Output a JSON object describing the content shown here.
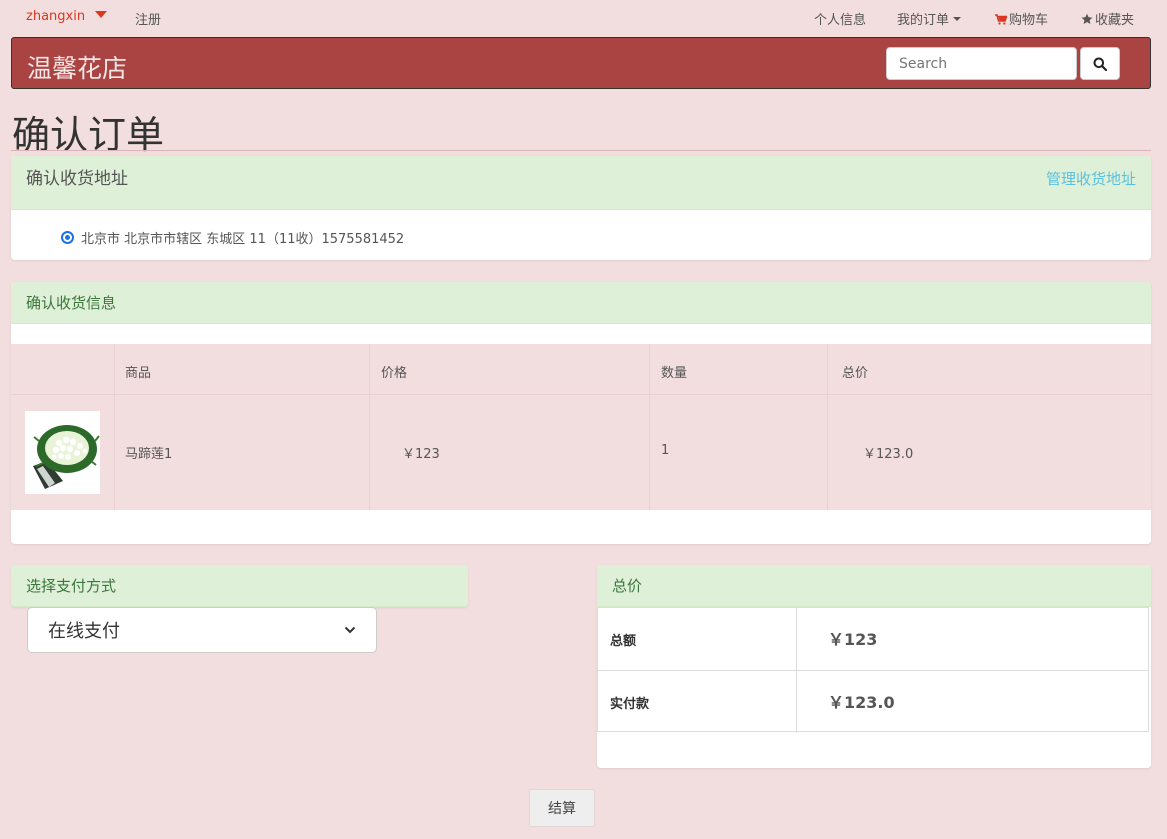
{
  "topbar": {
    "user": "zhangxin",
    "register": "注册",
    "profile": "个人信息",
    "orders": "我的订单",
    "cart": "购物车",
    "favorites": "收藏夹"
  },
  "navbar": {
    "brand": "温馨花店",
    "search_placeholder": "Search"
  },
  "page": {
    "title": "确认订单"
  },
  "address": {
    "heading": "确认收货地址",
    "manage_link": "管理收货地址",
    "selected": "北京市 北京市市辖区 东城区 11（11收）1575581452"
  },
  "goods": {
    "heading": "确认收货信息",
    "columns": [
      "商品",
      "价格",
      "数量",
      "总价"
    ],
    "rows": [
      {
        "name": "马蹄莲1",
        "price": "￥123",
        "quantity": "1",
        "total": "￥123.0"
      }
    ]
  },
  "payment": {
    "heading": "选择支付方式",
    "selected": "在线支付"
  },
  "summary": {
    "heading": "总价",
    "amount_label": "总额",
    "amount_value": "￥123",
    "paid_label": "实付款",
    "paid_value": "￥123.0"
  },
  "checkout": {
    "label": "结算"
  },
  "colors": {
    "background": "#f2dede",
    "navbar": "#a94442",
    "panel_head": "#dff0d8",
    "link": "#5bc0de",
    "user": "#d9381e"
  }
}
